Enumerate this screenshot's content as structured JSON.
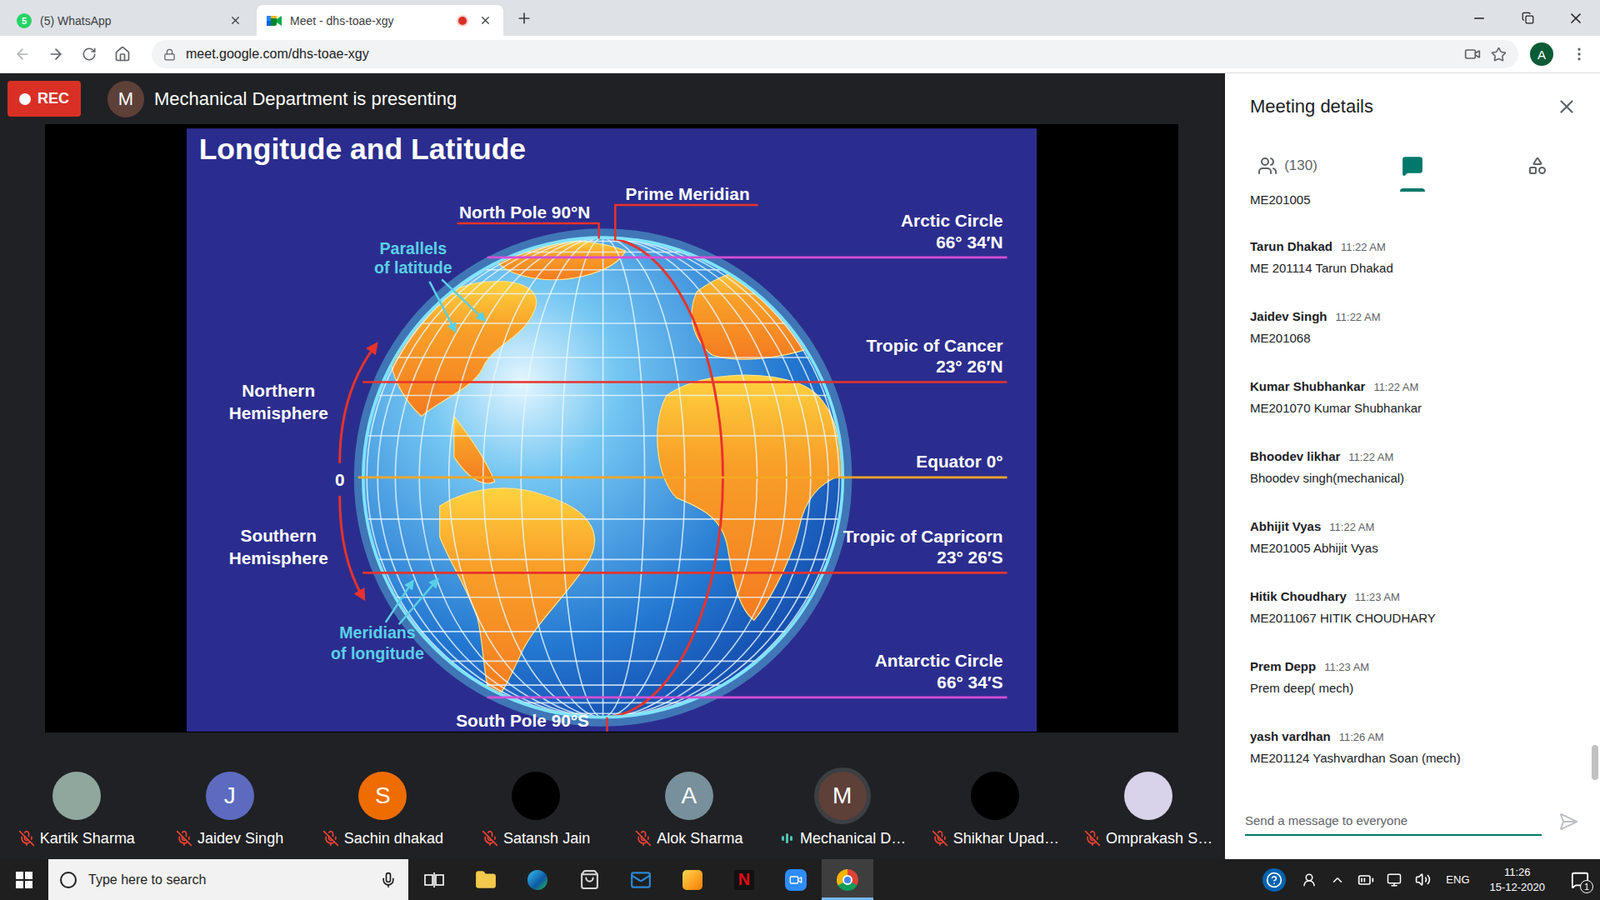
{
  "browser": {
    "tabs": [
      {
        "kind": "whatsapp",
        "favicon_text": "5",
        "label": "(5) WhatsApp",
        "selected": false,
        "recording": false
      },
      {
        "kind": "meet",
        "favicon_text": "",
        "label": "Meet - dhs-toae-xgy",
        "selected": true,
        "recording": true
      }
    ],
    "url": "meet.google.com/dhs-toae-xgy",
    "profile": "A"
  },
  "presentation": {
    "rec": "REC",
    "presenter_initial": "M",
    "presenter_text": "Mechanical Department is presenting"
  },
  "slide": {
    "title": "Longitude and Latitude",
    "north_pole": "North Pole 90°N",
    "south_pole": "South Pole 90°S",
    "prime_meridian": "Prime Meridian",
    "parallels_label": [
      "Parallels",
      "of latitude"
    ],
    "meridians_label": [
      "Meridians",
      "of longitude"
    ],
    "northern": [
      "Northern",
      "Hemisphere"
    ],
    "southern": [
      "Southern",
      "Hemisphere"
    ],
    "zero": "0",
    "circles": [
      {
        "name": "Arctic Circle",
        "value": "66° 34′N",
        "degrees": 66.57,
        "color": "#d54fd6"
      },
      {
        "name": "Tropic of Cancer",
        "value": "23° 26′N",
        "degrees": 23.43,
        "color": "#e8322b"
      },
      {
        "name": "Equator 0°",
        "value": "",
        "degrees": 0,
        "color": "#f5a623"
      },
      {
        "name": "Tropic of Capricorn",
        "value": "23° 26′S",
        "degrees": -23.43,
        "color": "#e8322b"
      },
      {
        "name": "Antarctic Circle",
        "value": "66° 34′S",
        "degrees": -66.57,
        "color": "#d54fd6"
      }
    ]
  },
  "participants": [
    {
      "name": "Kartik Sharma",
      "kind": "photo",
      "initial": "",
      "color": "#8fa79c",
      "muted": true,
      "speaking": false,
      "highlighted": false
    },
    {
      "name": "Jaidev Singh",
      "kind": "letter",
      "initial": "J",
      "color": "#5c6bc0",
      "muted": true,
      "speaking": false,
      "highlighted": false
    },
    {
      "name": "Sachin dhakad",
      "kind": "letter",
      "initial": "S",
      "color": "#ef6c00",
      "muted": true,
      "speaking": false,
      "highlighted": false
    },
    {
      "name": "Satansh Jain",
      "kind": "blank",
      "initial": "",
      "color": "#000000",
      "muted": true,
      "speaking": false,
      "highlighted": false
    },
    {
      "name": "Alok Sharma",
      "kind": "letter",
      "initial": "A",
      "color": "#78909c",
      "muted": true,
      "speaking": false,
      "highlighted": false
    },
    {
      "name": "Mechanical D…",
      "kind": "letter",
      "initial": "M",
      "color": "#5d4037",
      "muted": false,
      "speaking": true,
      "highlighted": true
    },
    {
      "name": "Shikhar Upad…",
      "kind": "blank",
      "initial": "",
      "color": "#000000",
      "muted": true,
      "speaking": false,
      "highlighted": false
    },
    {
      "name": "Omprakash S…",
      "kind": "photo",
      "initial": "",
      "color": "#d8d2ea",
      "muted": true,
      "speaking": false,
      "highlighted": false
    }
  ],
  "details": {
    "title": "Meeting details",
    "tabs": [
      {
        "kind": "people",
        "label": "(130)",
        "selected": false
      },
      {
        "kind": "chat",
        "label": "",
        "selected": true
      },
      {
        "kind": "activities",
        "label": "",
        "selected": false
      }
    ],
    "top_fragment": "ME201005",
    "messages": [
      {
        "sender": "Tarun Dhakad",
        "time": "11:22 AM",
        "text": "ME 201114 Tarun Dhakad"
      },
      {
        "sender": "Jaidev Singh",
        "time": "11:22 AM",
        "text": "ME201068"
      },
      {
        "sender": "Kumar Shubhankar",
        "time": "11:22 AM",
        "text": "ME201070 Kumar Shubhankar"
      },
      {
        "sender": "Bhoodev likhar",
        "time": "11:22 AM",
        "text": "Bhoodev singh(mechanical)"
      },
      {
        "sender": "Abhijit Vyas",
        "time": "11:22 AM",
        "text": "ME201005 Abhijit Vyas"
      },
      {
        "sender": "Hitik Choudhary",
        "time": "11:23 AM",
        "text": "ME2011067 HITIK CHOUDHARY"
      },
      {
        "sender": "Prem Depp",
        "time": "11:23 AM",
        "text": "Prem deep( mech)"
      },
      {
        "sender": "yash vardhan",
        "time": "11:26 AM",
        "text": "ME201124 Yashvardhan Soan (mech)"
      }
    ],
    "scrolled_to_bottom": true,
    "placeholder": "Send a message to everyone"
  },
  "taskbar": {
    "search_placeholder": "Type here to search",
    "apps": [
      {
        "kind": "taskview",
        "label": "",
        "active": false
      },
      {
        "kind": "explorer",
        "label": "",
        "active": false
      },
      {
        "kind": "edge",
        "label": "",
        "active": false
      },
      {
        "kind": "store",
        "label": "",
        "active": false
      },
      {
        "kind": "mail",
        "label": "",
        "active": false
      },
      {
        "kind": "paint",
        "label": "",
        "active": false
      },
      {
        "kind": "netflix",
        "label": "N",
        "active": false
      },
      {
        "kind": "zoom",
        "label": "",
        "active": false
      },
      {
        "kind": "chrome",
        "label": "",
        "active": true
      }
    ],
    "language": "ENG",
    "time": "11:26",
    "date": "15-12-2020",
    "notifications": "1"
  }
}
